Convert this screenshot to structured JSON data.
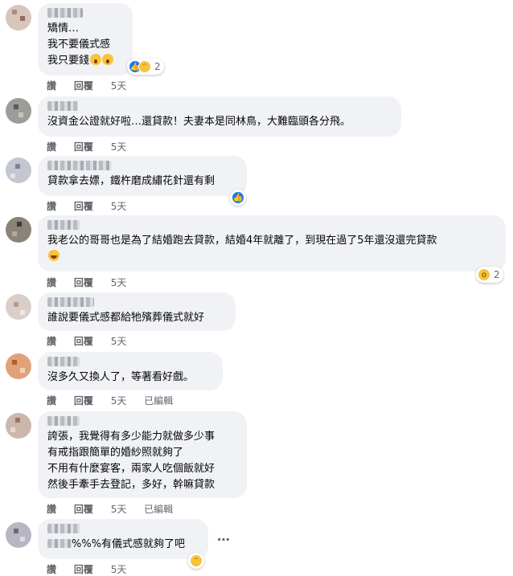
{
  "labels": {
    "like": "讚",
    "reply": "回覆",
    "time": "5天",
    "edited": "已編輯"
  },
  "comments": [
    {
      "lines": [
        "矯情…",
        "我不要儀式感",
        "我只要錢"
      ],
      "reaction_count": "2",
      "reaction_icons": [
        "like-icon",
        "haha-icon"
      ]
    },
    {
      "lines": [
        "沒資金公證就好啦…還貸款！夫妻本是同林鳥，大難臨頭各分飛。"
      ]
    },
    {
      "lines": [
        "貸款拿去嫖，鐵杵磨成繡花針還有剩"
      ],
      "reaction_icons": [
        "like-icon"
      ]
    },
    {
      "lines": [
        "我老公的哥哥也是為了結婚跑去貸款，結婚4年就離了，到現在過了5年還沒還完貸款"
      ],
      "reaction_count": "2",
      "reaction_icons": [
        "wow-icon"
      ]
    },
    {
      "lines": [
        "誰說要儀式感都給牠殯葬儀式就好"
      ]
    },
    {
      "lines": [
        "沒多久又換人了，等著看好戲。"
      ]
    },
    {
      "lines": [
        "誇張，我覺得有多少能力就做多少事",
        "有戒指跟簡單的婚紗照就夠了",
        "不用有什麼宴客，兩家人吃個飯就好",
        "然後手牽手去登記，多好，幹嘛貸款"
      ]
    },
    {
      "lines": [
        "%%%有儀式感就夠了吧"
      ],
      "reaction_icons": [
        "haha-icon"
      ]
    }
  ],
  "colors": {
    "bubble": "#f0f2f5",
    "meta_text": "#65676b",
    "like_blue": "#1877f2",
    "emoji_yellow": "#f7c33b"
  }
}
